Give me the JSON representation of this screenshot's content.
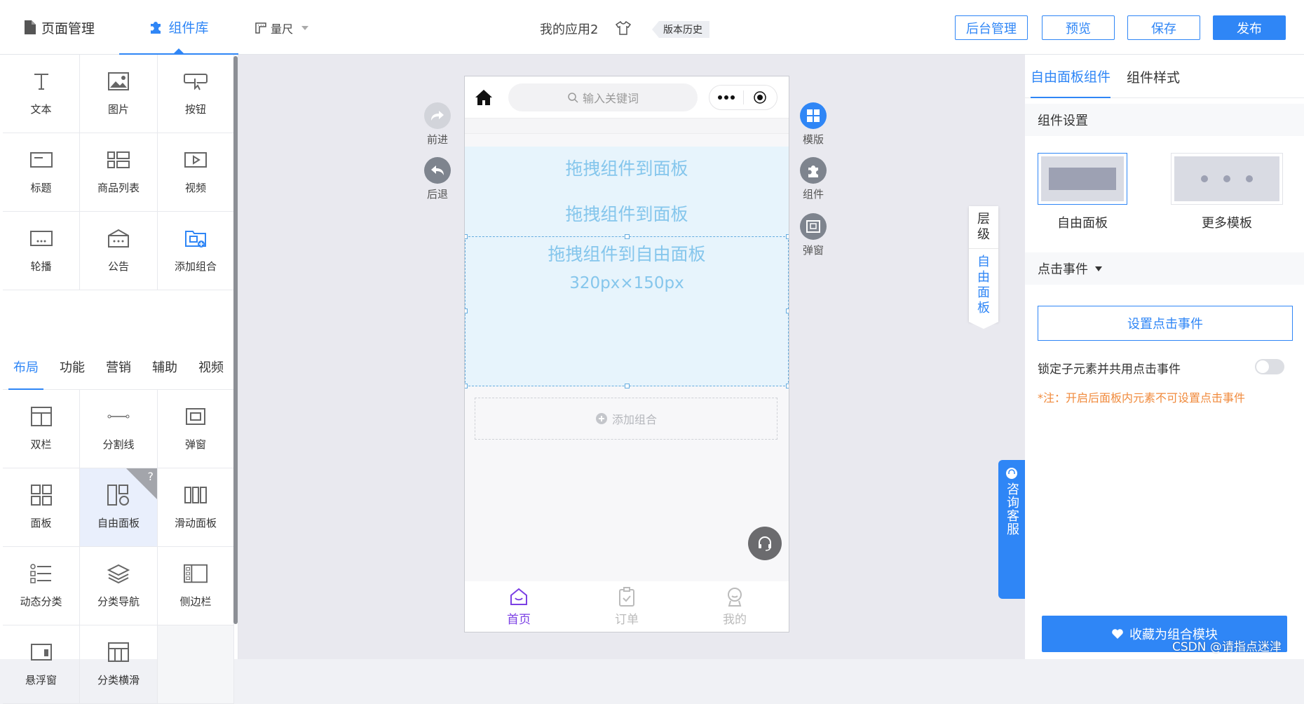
{
  "header": {
    "tabs": [
      {
        "label": "页面管理",
        "icon": "file-icon"
      },
      {
        "label": "组件库",
        "icon": "puzzle-icon"
      }
    ],
    "ruler_label": "量尺",
    "app_name": "我的应用2",
    "version_history": "版本历史",
    "buttons": {
      "admin": "后台管理",
      "preview": "预览",
      "save": "保存",
      "publish": "发布"
    }
  },
  "left_panel": {
    "basic_components": [
      {
        "label": "文本",
        "icon": "text-icon"
      },
      {
        "label": "图片",
        "icon": "image-icon"
      },
      {
        "label": "按钮",
        "icon": "button-icon"
      },
      {
        "label": "标题",
        "icon": "title-icon"
      },
      {
        "label": "商品列表",
        "icon": "product-list-icon"
      },
      {
        "label": "视频",
        "icon": "video-icon"
      },
      {
        "label": "轮播",
        "icon": "carousel-icon"
      },
      {
        "label": "公告",
        "icon": "notice-icon"
      },
      {
        "label": "添加组合",
        "icon": "add-combo-icon"
      }
    ],
    "subtabs": [
      "布局",
      "功能",
      "营销",
      "辅助",
      "视频"
    ],
    "active_subtab": "布局",
    "layout_components": [
      {
        "label": "双栏",
        "icon": "two-column-icon"
      },
      {
        "label": "分割线",
        "icon": "divider-icon"
      },
      {
        "label": "弹窗",
        "icon": "popup-icon"
      },
      {
        "label": "面板",
        "icon": "panel-icon"
      },
      {
        "label": "自由面板",
        "icon": "free-panel-icon",
        "selected": true,
        "help": "?"
      },
      {
        "label": "滑动面板",
        "icon": "slide-panel-icon"
      },
      {
        "label": "动态分类",
        "icon": "dynamic-category-icon"
      },
      {
        "label": "分类导航",
        "icon": "category-nav-icon"
      },
      {
        "label": "侧边栏",
        "icon": "sidebar-icon"
      },
      {
        "label": "悬浮窗",
        "icon": "float-window-icon"
      },
      {
        "label": "分类横滑",
        "icon": "category-slide-icon"
      }
    ]
  },
  "canvas": {
    "forward": "前进",
    "back": "后退",
    "template": "模版",
    "component": "组件",
    "popup": "弹窗",
    "layers": "层级",
    "free_panel_tab": "自由面板",
    "consult": "咨询客服",
    "phone": {
      "search_placeholder": "输入关键词",
      "drop_hint_1": "拖拽组件到面板",
      "drop_hint_2": "拖拽组件到面板",
      "free_panel_hint": "拖拽组件到自由面板",
      "free_panel_size": "320px×150px",
      "add_combo": "添加组合",
      "tabbar": [
        {
          "label": "首页",
          "icon": "home-smile-icon",
          "active": true
        },
        {
          "label": "订单",
          "icon": "order-icon",
          "active": false
        },
        {
          "label": "我的",
          "icon": "profile-icon",
          "active": false
        }
      ]
    }
  },
  "right_panel": {
    "tabs": [
      "自由面板组件",
      "组件样式"
    ],
    "active_tab": "自由面板组件",
    "settings_title": "组件设置",
    "templates": [
      {
        "label": "自由面板",
        "selected": true
      },
      {
        "label": "更多模板",
        "selected": false
      }
    ],
    "click_event_label": "点击事件",
    "set_click_event": "设置点击事件",
    "lock_children_label": "锁定子元素并共用点击事件",
    "lock_children_on": false,
    "note": "*注：开启后面板内元素不可设置点击事件",
    "favorite_button": "收藏为组合模块"
  },
  "watermark": "CSDN @请指点迷津",
  "colors": {
    "accent": "#2f86f6",
    "note": "#f08a3c",
    "active_tabbar": "#7b3fe4",
    "drop_text": "#85c6ec"
  }
}
